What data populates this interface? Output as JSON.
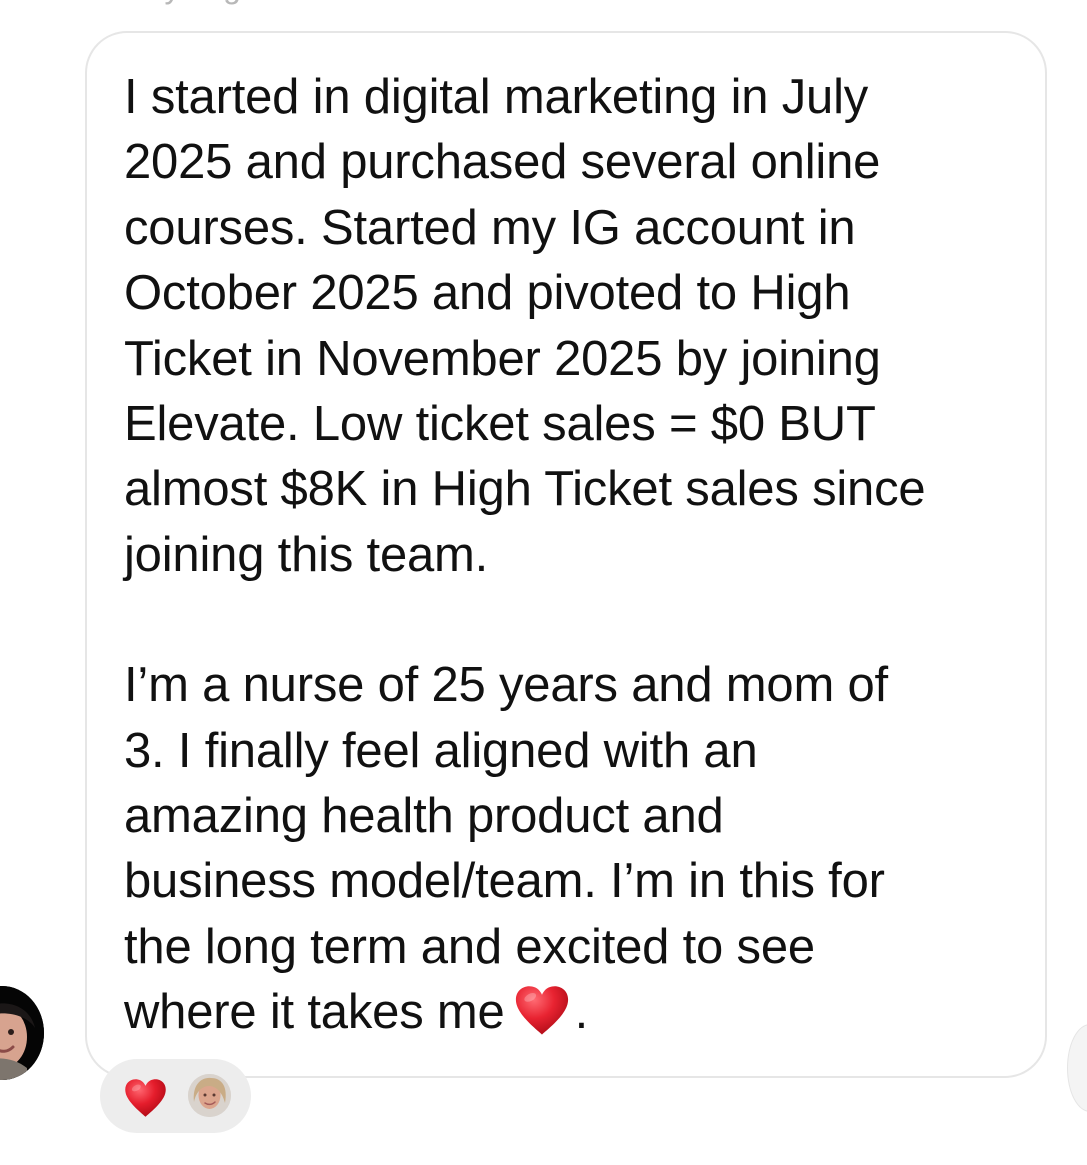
{
  "top_fragment": "...by ...ig ...",
  "message": {
    "paragraph_1": "I started in digital marketing in July\n2025 and purchased several online\ncourses. Started my IG account in\nOctober 2025 and pivoted to High\nTicket in November 2025 by joining\nElevate. Low ticket sales = $0 BUT\nalmost $8K in High Ticket sales since\njoining this team.",
    "paragraph_2_before_heart": "I’m a nurse of 25 years and mom of\n3. I finally feel aligned with an\namazing health product and\nbusiness model/team. I’m in this for\nthe long term and excited to see\nwhere it takes me",
    "paragraph_2_after_heart": "."
  },
  "icons": {
    "sender_avatar": "profile-photo",
    "inline_heart": "red-heart-icon",
    "reaction_heart": "red-heart-icon",
    "reactor_avatar": "profile-photo"
  },
  "colors": {
    "heart": "#e5202f",
    "bubble_border": "#e6e6e6",
    "reaction_background": "#ededed"
  }
}
